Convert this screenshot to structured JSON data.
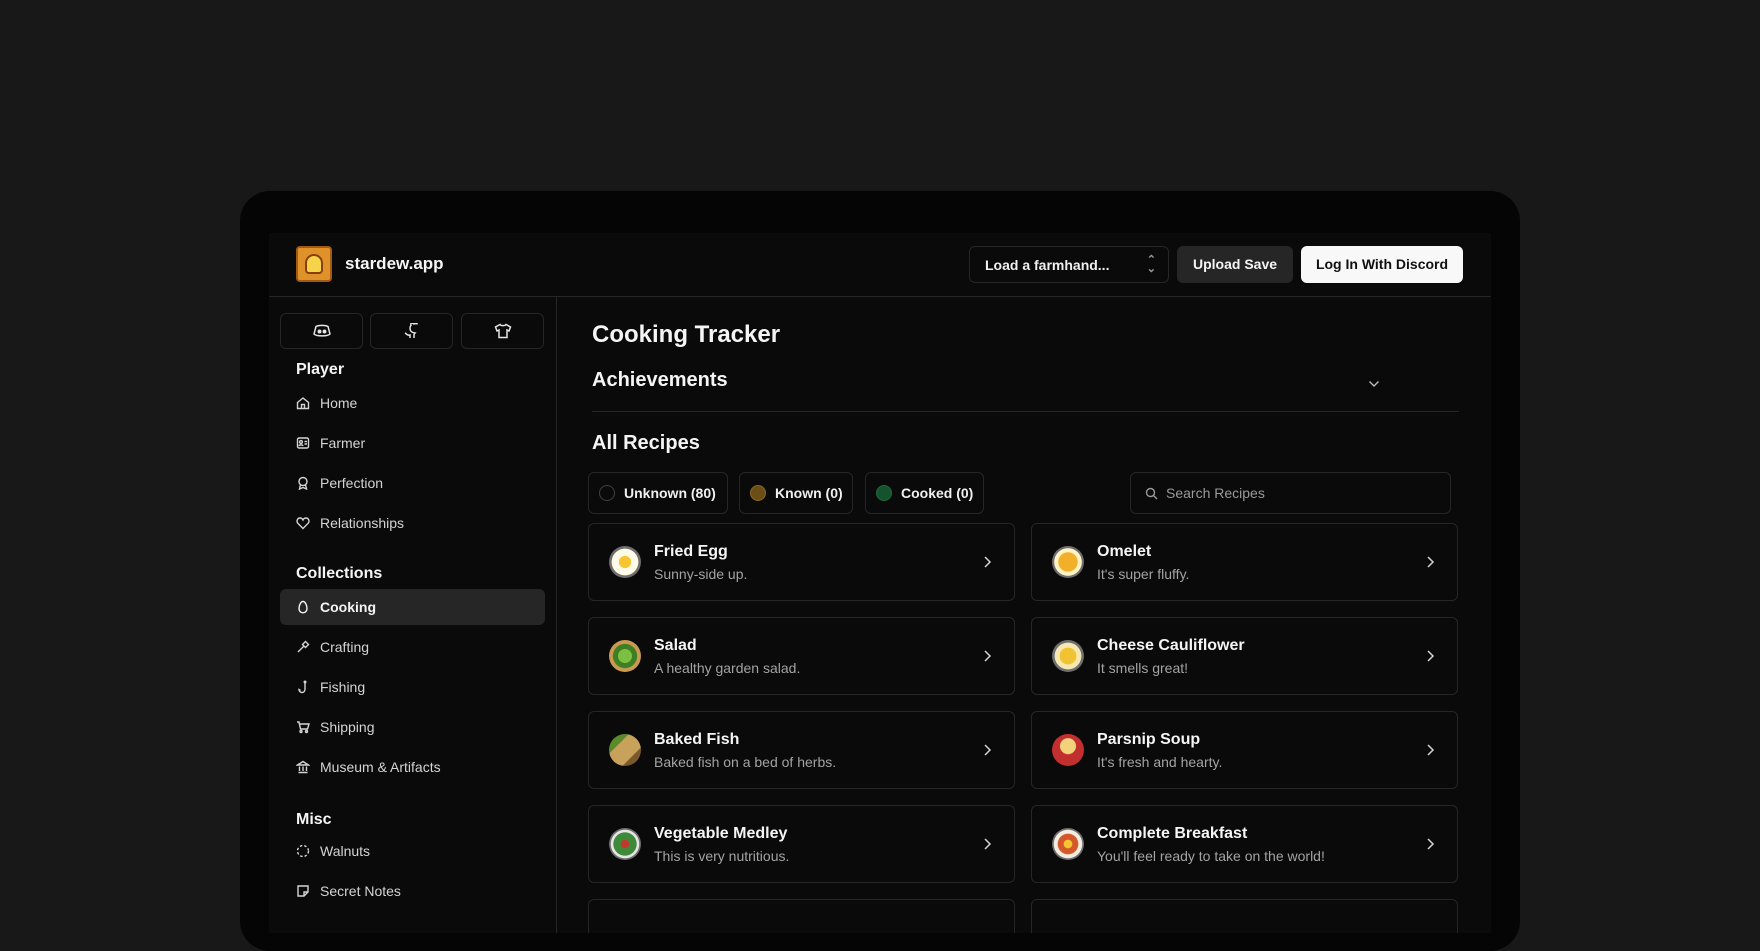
{
  "app": {
    "brand": "stardew.app",
    "farmhand_select": "Load a farmhand...",
    "upload_label": "Upload Save",
    "login_label": "Log In With Discord"
  },
  "sidebar": {
    "icon_buttons": [
      "discord-icon",
      "github-icon",
      "shirt-icon"
    ],
    "sections": [
      {
        "title": "Player",
        "items": [
          {
            "label": "Home",
            "icon": "home-icon"
          },
          {
            "label": "Farmer",
            "icon": "farmer-icon"
          },
          {
            "label": "Perfection",
            "icon": "award-icon"
          },
          {
            "label": "Relationships",
            "icon": "heart-icon"
          }
        ]
      },
      {
        "title": "Collections",
        "items": [
          {
            "label": "Cooking",
            "icon": "egg-icon",
            "active": true
          },
          {
            "label": "Crafting",
            "icon": "hammer-icon"
          },
          {
            "label": "Fishing",
            "icon": "fishhook-icon"
          },
          {
            "label": "Shipping",
            "icon": "cart-icon"
          },
          {
            "label": "Museum & Artifacts",
            "icon": "museum-icon"
          }
        ]
      },
      {
        "title": "Misc",
        "items": [
          {
            "label": "Walnuts",
            "icon": "loader-icon"
          },
          {
            "label": "Secret Notes",
            "icon": "note-icon"
          }
        ]
      }
    ]
  },
  "main": {
    "title": "Cooking Tracker",
    "achievements_title": "Achievements",
    "recipes_title": "All Recipes",
    "filters": [
      {
        "label": "Unknown (80)",
        "color": "#0a0a0a"
      },
      {
        "label": "Known (0)",
        "color": "#6b4e16"
      },
      {
        "label": "Cooked (0)",
        "color": "#14532d"
      }
    ],
    "search_placeholder": "Search Recipes",
    "recipes": [
      {
        "name": "Fried Egg",
        "desc": "Sunny-side up.",
        "color": "#f4d54a"
      },
      {
        "name": "Omelet",
        "desc": "It's super fluffy.",
        "color": "#f2b02a"
      },
      {
        "name": "Salad",
        "desc": "A healthy garden salad.",
        "color": "#4e9a2a"
      },
      {
        "name": "Cheese Cauliflower",
        "desc": "It smells great!",
        "color": "#f1c232"
      },
      {
        "name": "Baked Fish",
        "desc": "Baked fish on a bed of herbs.",
        "color": "#b08a3c"
      },
      {
        "name": "Parsnip Soup",
        "desc": "It's fresh and hearty.",
        "color": "#c22f2f"
      },
      {
        "name": "Vegetable Medley",
        "desc": "This is very nutritious.",
        "color": "#3f8a3a"
      },
      {
        "name": "Complete Breakfast",
        "desc": "You'll feel ready to take on the world!",
        "color": "#d4582a"
      }
    ]
  }
}
